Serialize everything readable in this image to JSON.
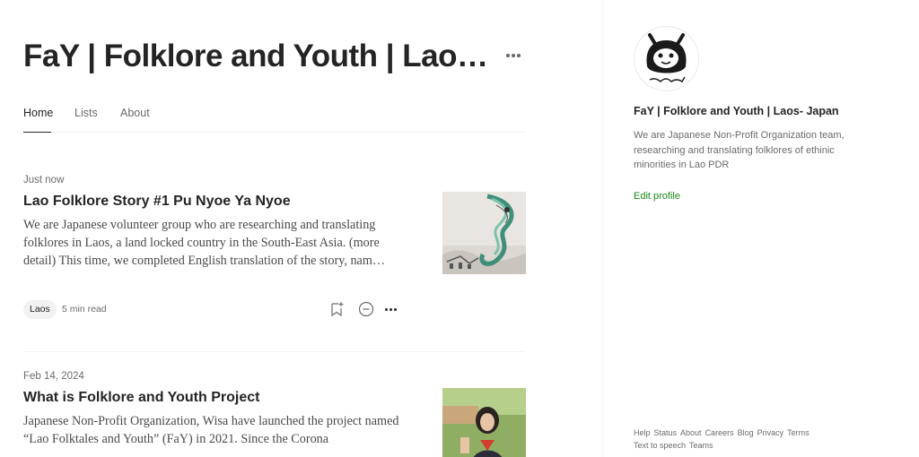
{
  "publication": {
    "title": "FaY | Folklore and Youth | Laos- J..."
  },
  "tabs": [
    {
      "label": "Home",
      "active": true
    },
    {
      "label": "Lists",
      "active": false
    },
    {
      "label": "About",
      "active": false
    }
  ],
  "posts": [
    {
      "date": "Just now",
      "title": "Lao Folklore Story #1 Pu Nyoe Ya Nyoe",
      "excerpt": "We are Japanese volunteer group who are researching and translating folklores in Laos, a land locked country in the South-East Asia. (more detail) This time, we completed English translation of the story, nam…",
      "tag": "Laos",
      "read_time": "5 min read",
      "thumb_icon": "folklore-painting-thumbnail"
    },
    {
      "date": "Feb 14, 2024",
      "title": "What is Folklore and Youth Project",
      "excerpt": "Japanese Non-Profit Organization, Wisa have launched the project named “Lao Folktales and Youth” (FaY) in 2021. Since the Corona",
      "thumb_icon": "person-photo-thumbnail"
    }
  ],
  "sidebar": {
    "avatar_icon": "publication-logo-icon",
    "name": "FaY | Folklore and Youth | Laos- Japan",
    "bio": "We are Japanese Non-Profit Organization team, researching and translating folklores of ethinic minorities in Lao PDR",
    "edit_profile": "Edit profile"
  },
  "footer": {
    "links": [
      "Help",
      "Status",
      "About",
      "Careers",
      "Blog",
      "Privacy",
      "Terms",
      "Text to speech",
      "Teams"
    ]
  },
  "colors": {
    "accent_green": "#1a8917",
    "text_primary": "#242424",
    "text_secondary": "#6b6b6b",
    "divider": "#f2f2f2"
  }
}
